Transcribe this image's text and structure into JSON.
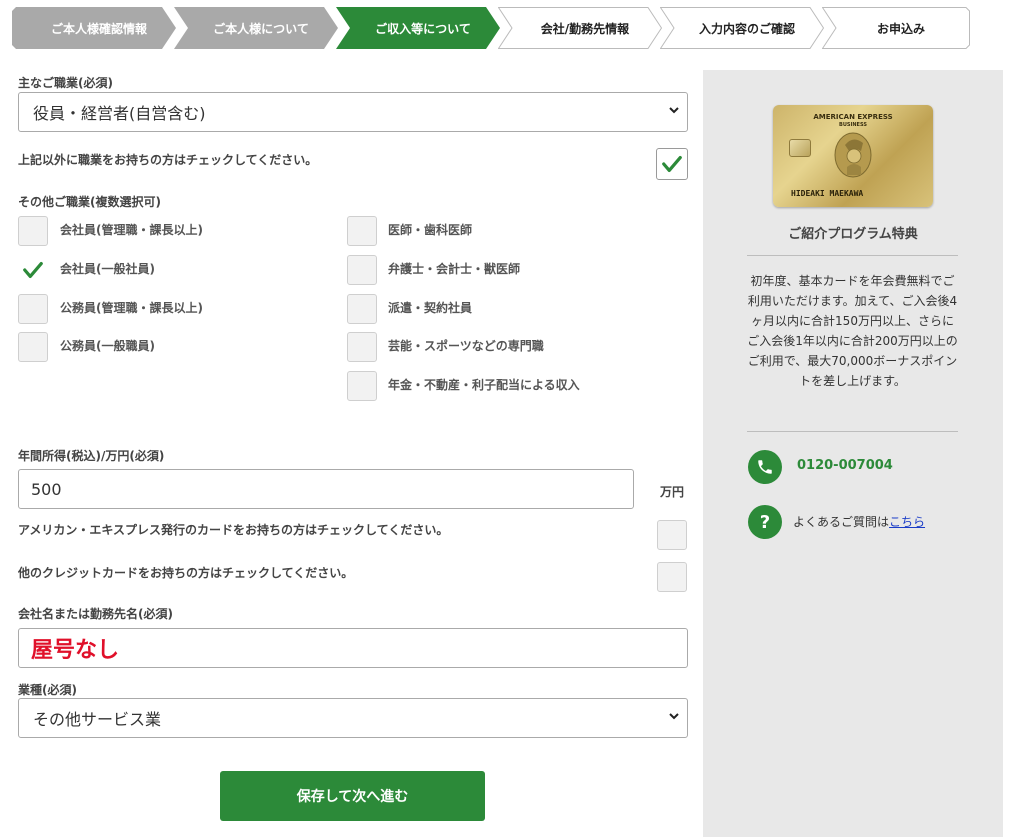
{
  "steps": [
    {
      "label": "ご本人様確認情報",
      "state": "done"
    },
    {
      "label": "ご本人様について",
      "state": "done"
    },
    {
      "label": "ご収入等について",
      "state": "current"
    },
    {
      "label": "会社/勤務先情報",
      "state": "todo"
    },
    {
      "label": "入力内容のご確認",
      "state": "todo"
    },
    {
      "label": "お申込み",
      "state": "todo"
    }
  ],
  "colors": {
    "accent": "#2c8a39",
    "done": "#a9a9a9",
    "company_text": "#e0102a"
  },
  "occupation": {
    "label": "主なご職業(必須)",
    "value": "役員・経営者(自営含む)"
  },
  "other_occupation_check": {
    "text": "上記以外に職業をお持ちの方はチェックしてください。",
    "checked": true
  },
  "other_occupations": {
    "label": "その他ご職業(複数選択可)",
    "left": [
      {
        "label": "会社員(管理職・課長以上)",
        "checked": false
      },
      {
        "label": "会社員(一般社員)",
        "checked": true
      },
      {
        "label": "公務員(管理職・課長以上)",
        "checked": false
      },
      {
        "label": "公務員(一般職員)",
        "checked": false
      }
    ],
    "right": [
      {
        "label": "医師・歯科医師",
        "checked": false
      },
      {
        "label": "弁護士・会計士・獣医師",
        "checked": false
      },
      {
        "label": "派遣・契約社員",
        "checked": false
      },
      {
        "label": "芸能・スポーツなどの専門職",
        "checked": false
      },
      {
        "label": "年金・不動産・利子配当による収入",
        "checked": false
      }
    ]
  },
  "income": {
    "label": "年間所得(税込)/万円(必須)",
    "value": "500",
    "unit": "万円"
  },
  "amex_card_check": {
    "text": "アメリカン・エキスプレス発行のカードをお持ちの方はチェックしてください。",
    "checked": false
  },
  "other_card_check": {
    "text": "他のクレジットカードをお持ちの方はチェックしてください。",
    "checked": false
  },
  "company": {
    "label": "会社名または勤務先名(必須)",
    "value": "屋号なし"
  },
  "industry": {
    "label": "業種(必須)",
    "value": "その他サービス業"
  },
  "submit_label": "保存して次へ進む",
  "sidebar": {
    "card": {
      "brand_line1": "AMERICAN EXPRESS",
      "brand_line2": "BUSINESS",
      "holder_name": "HIDEAKI MAEKAWA"
    },
    "program_title": "ご紹介プログラム特典",
    "program_text": "初年度、基本カードを年会費無料でご利用いただけます。加えて、ご入会後4ヶ月以内に合計150万円以上、さらにご入会後1年以内に合計200万円以上のご利用で、最大70,000ボーナスポイントを差し上げます。",
    "phone": "0120-007004",
    "faq_text": "よくあるご質問は",
    "faq_link": "こちら"
  }
}
